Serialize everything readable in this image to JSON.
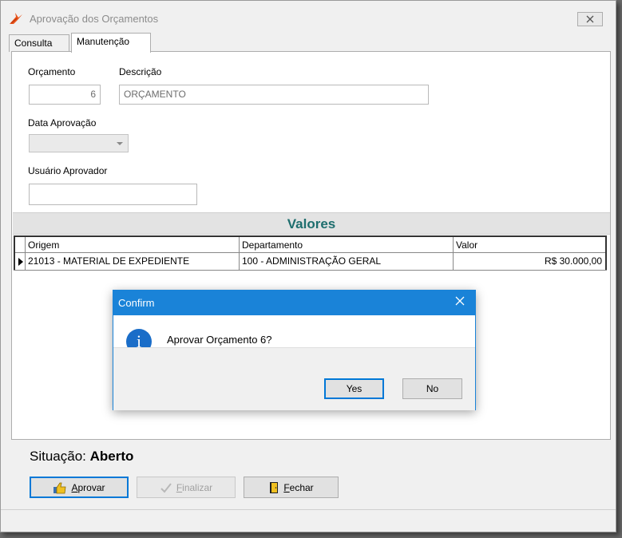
{
  "window": {
    "title": "Aprovação dos Orçamentos",
    "close_icon": "close-icon"
  },
  "tabs": [
    {
      "label": "Consulta"
    },
    {
      "label": "Manutenção"
    }
  ],
  "form": {
    "orcamento_label": "Orçamento",
    "orcamento_value": "6",
    "descricao_label": "Descrição",
    "descricao_value": "ORÇAMENTO",
    "data_aprovacao_label": "Data Aprovação",
    "data_aprovacao_value": "",
    "usuario_aprovador_label": "Usuário Aprovador",
    "usuario_aprovador_value": ""
  },
  "valores": {
    "title": "Valores",
    "columns": [
      "Origem",
      "Departamento",
      "Valor"
    ],
    "rows": [
      {
        "origem": "21013 - MATERIAL DE EXPEDIENTE",
        "departamento": "100 - ADMINISTRAÇÃO GERAL",
        "valor": "R$ 30.000,00"
      }
    ]
  },
  "situacao": {
    "label": "Situação:",
    "value": "Aberto"
  },
  "buttons": {
    "aprovar": {
      "mnemonic": "A",
      "rest": "provar"
    },
    "finalizar": {
      "mnemonic": "F",
      "rest": "inalizar"
    },
    "fechar": {
      "mnemonic": "F",
      "rest": "echar"
    }
  },
  "dialog": {
    "title": "Confirm",
    "message": "Aprovar Orçamento 6?",
    "yes": "Yes",
    "no": "No"
  },
  "colors": {
    "accent": "#1a83d8",
    "valores_title": "#1e6e6e"
  }
}
